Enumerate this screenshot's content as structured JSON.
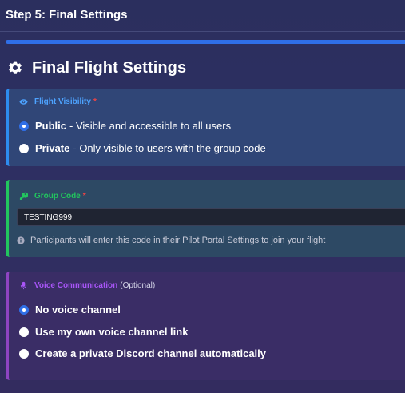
{
  "header": {
    "step_title": "Step 5: Final Settings"
  },
  "progress": {
    "percent": 100
  },
  "page": {
    "heading": "Final Flight Settings",
    "heading_icon": "gear-icon"
  },
  "visibility": {
    "label": "Flight Visibility",
    "required_mark": "*",
    "icon": "eye-icon",
    "label_color": "#4da3ff",
    "options": [
      {
        "title": "Public",
        "desc": "- Visible and accessible to all users",
        "selected": true
      },
      {
        "title": "Private",
        "desc": "- Only visible to users with the group code",
        "selected": false
      }
    ]
  },
  "group_code": {
    "label": "Group Code",
    "required_mark": "*",
    "icon": "key-icon",
    "label_color": "#22c55e",
    "value": "TESTING999",
    "help": "Participants will enter this code in their Pilot Portal Settings to join your flight",
    "help_icon": "info-icon"
  },
  "voice": {
    "label": "Voice Communication",
    "optional_text": "(Optional)",
    "icon": "microphone-icon",
    "label_color": "#a855f7",
    "options": [
      {
        "title": "No voice channel",
        "selected": true
      },
      {
        "title": "Use my own voice channel link",
        "selected": false
      },
      {
        "title": "Create a private Discord channel automatically",
        "selected": false
      }
    ]
  },
  "colors": {
    "accent": "#2f6fe8",
    "required": "#ef4444"
  }
}
